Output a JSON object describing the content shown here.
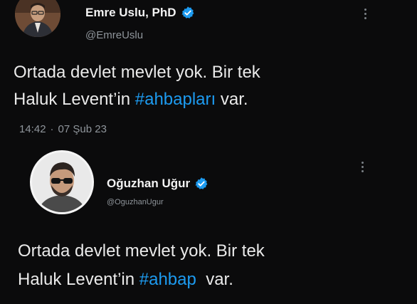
{
  "tweet1": {
    "display_name": "Emre Uslu, PhD",
    "handle": "@EmreUslu",
    "line1": "Ortada devlet mevlet yok. Bir tek",
    "line2_prefix": "Haluk Levent’in ",
    "line2_hashtag": "#ahbapları",
    "line2_suffix": " var.",
    "time": "14:42",
    "separator": "·",
    "date": "07 Şub 23",
    "avatar_icon": "avatar-photo-man-suit",
    "verified_icon": "verified-badge-icon"
  },
  "tweet2": {
    "display_name": "Oğuzhan Uğur",
    "handle": "@OguzhanUgur",
    "line1": "Ortada devlet mevlet yok. Bir tek",
    "line2_prefix": "Haluk Levent’in ",
    "line2_hashtag": "#ahbap",
    "line2_suffix": "  var.",
    "avatar_icon": "avatar-photo-man-sunglasses",
    "verified_icon": "verified-badge-icon"
  },
  "colors": {
    "background": "#0b0b0c",
    "text": "#eaeaea",
    "muted": "#8f959b",
    "link": "#1d9bf0",
    "verified": "#1d9bf0"
  }
}
